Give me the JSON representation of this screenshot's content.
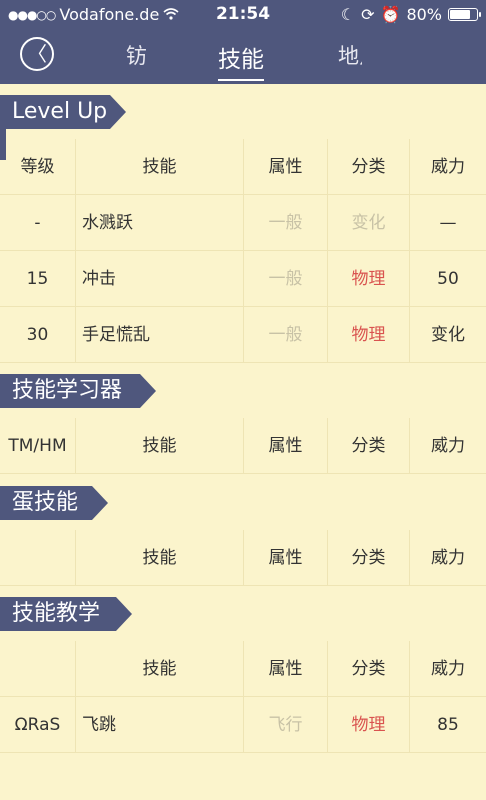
{
  "status": {
    "carrier": "Vodafone.de",
    "time": "21:54",
    "battery": "80%",
    "battery_level": 0.8
  },
  "nav": {
    "back": "〈",
    "tabs": [
      "钫",
      "技能",
      "地点"
    ],
    "active_tab": 1
  },
  "sections": {
    "levelup": {
      "title": "Level Up",
      "header": [
        "等级",
        "技能",
        "属性",
        "分类",
        "威力"
      ],
      "rows": [
        [
          "-",
          "水溅跃",
          "一般",
          "变化",
          "—"
        ],
        [
          "15",
          "冲击",
          "一般",
          "物理",
          "50"
        ],
        [
          "30",
          "手足慌乱",
          "一般",
          "物理",
          "变化"
        ]
      ]
    },
    "tm": {
      "title": "技能学习器",
      "header": [
        "TM/HM",
        "技能",
        "属性",
        "分类",
        "威力"
      ]
    },
    "egg": {
      "title": "蛋技能",
      "header": [
        "",
        "技能",
        "属性",
        "分类",
        "威力"
      ]
    },
    "tutor": {
      "title": "技能教学",
      "header": [
        "",
        "技能",
        "属性",
        "分类",
        "威力"
      ],
      "rows": [
        [
          "ΩRaS",
          "飞跳",
          "飞行",
          "物理",
          "85"
        ]
      ]
    }
  },
  "colors": {
    "header_bg": "#4f577d",
    "page_bg": "#fbf4cc",
    "physical": "#d9534f",
    "muted": "#c8c2a6"
  }
}
